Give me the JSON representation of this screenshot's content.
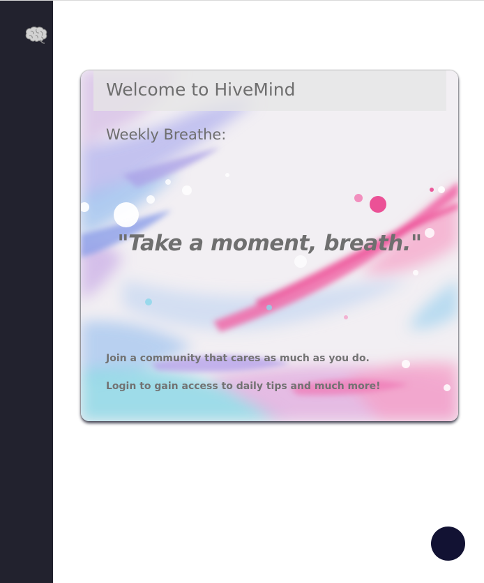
{
  "sidebar": {
    "logo_icon": "brain-icon"
  },
  "card": {
    "title": "Welcome to HiveMind",
    "weekly_label": "Weekly Breathe:",
    "quote": "\"Take a moment, breath.\"",
    "lines": [
      "Join a community that cares as much as you do.",
      "Login to gain access to daily tips and much more!"
    ],
    "background_colors": {
      "base": "#f2eff3",
      "pink": "#ef5fa6",
      "blue": "#8fb6ec",
      "purple": "#b89ae2",
      "teal": "#8fe0e4"
    }
  },
  "floating_button": {
    "color": "#121233"
  },
  "colors": {
    "sidebar": "#22222e",
    "text": "#6e6e6e"
  }
}
